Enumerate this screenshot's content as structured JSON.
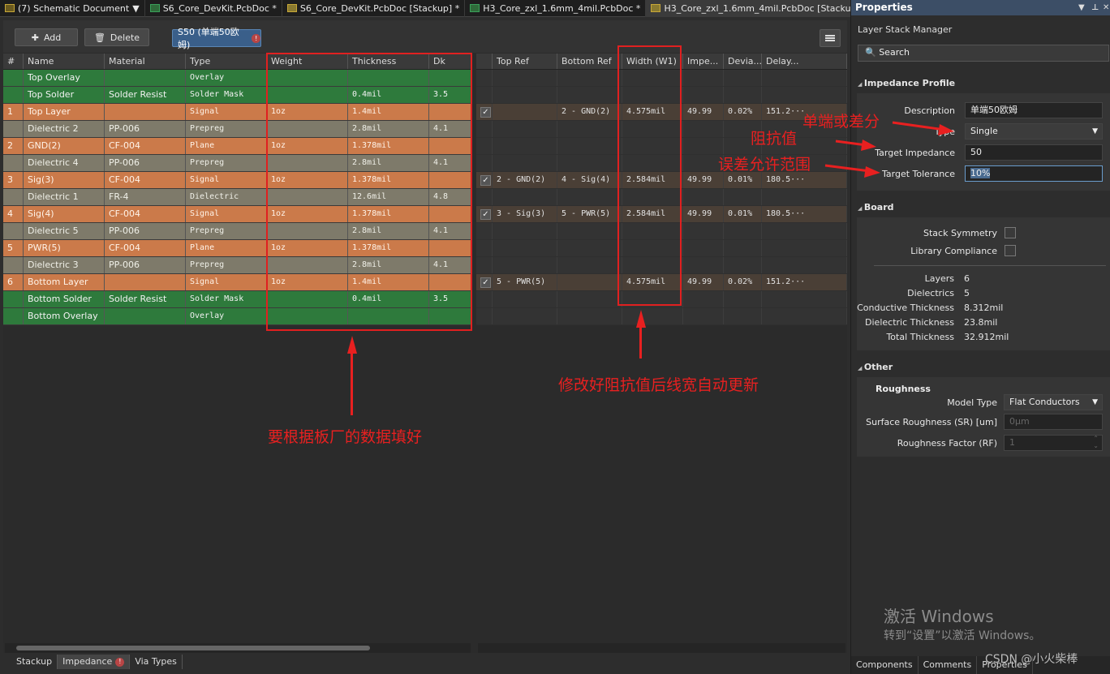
{
  "tabs": [
    "(7) Schematic Document",
    "S6_Core_DevKit.PcbDoc *",
    "S6_Core_DevKit.PcbDoc [Stackup] *",
    "H3_Core_zxl_1.6mm_4mil.PcbDoc *",
    "H3_Core_zxl_1.6mm_4mil.PcbDoc [Stackup] *"
  ],
  "toolbar": {
    "add": "Add",
    "delete": "Delete",
    "profile": "S50 (单端50欧姆)",
    "warn": "!"
  },
  "left_headers": [
    "#",
    "Name",
    "Material",
    "Type",
    "Weight",
    "Thickness",
    "Dk"
  ],
  "layers": [
    {
      "num": "",
      "name": "Top Overlay",
      "material": "",
      "type": "Overlay",
      "weight": "",
      "thickness": "",
      "dk": "",
      "cls": "Overlay",
      "ell": false
    },
    {
      "num": "",
      "name": "Top Solder",
      "material": "Solder Resist",
      "type": "Solder Mask",
      "weight": "",
      "thickness": "0.4mil",
      "dk": "3.5",
      "cls": "SolderMask",
      "ell": true
    },
    {
      "num": "1",
      "name": "Top Layer",
      "material": "",
      "type": "Signal",
      "weight": "1oz",
      "thickness": "1.4mil",
      "dk": "",
      "cls": "Signal",
      "ell": true
    },
    {
      "num": "",
      "name": "Dielectric 2",
      "material": "PP-006",
      "type": "Prepreg",
      "weight": "",
      "thickness": "2.8mil",
      "dk": "4.1",
      "cls": "Dielectric",
      "ell": true
    },
    {
      "num": "2",
      "name": "GND(2)",
      "material": "CF-004",
      "type": "Plane",
      "weight": "1oz",
      "thickness": "1.378mil",
      "dk": "",
      "cls": "Plane",
      "ell": true
    },
    {
      "num": "",
      "name": "Dielectric 4",
      "material": "PP-006",
      "type": "Prepreg",
      "weight": "",
      "thickness": "2.8mil",
      "dk": "4.1",
      "cls": "Dielectric",
      "ell": true
    },
    {
      "num": "3",
      "name": "Sig(3)",
      "material": "CF-004",
      "type": "Signal",
      "weight": "1oz",
      "thickness": "1.378mil",
      "dk": "",
      "cls": "Signal",
      "ell": true
    },
    {
      "num": "",
      "name": "Dielectric 1",
      "material": "FR-4",
      "type": "Dielectric",
      "weight": "",
      "thickness": "12.6mil",
      "dk": "4.8",
      "cls": "Dielectric",
      "ell": true
    },
    {
      "num": "4",
      "name": "Sig(4)",
      "material": "CF-004",
      "type": "Signal",
      "weight": "1oz",
      "thickness": "1.378mil",
      "dk": "",
      "cls": "Signal",
      "ell": true
    },
    {
      "num": "",
      "name": "Dielectric 5",
      "material": "PP-006",
      "type": "Prepreg",
      "weight": "",
      "thickness": "2.8mil",
      "dk": "4.1",
      "cls": "Dielectric",
      "ell": true
    },
    {
      "num": "5",
      "name": "PWR(5)",
      "material": "CF-004",
      "type": "Plane",
      "weight": "1oz",
      "thickness": "1.378mil",
      "dk": "",
      "cls": "Plane",
      "ell": true
    },
    {
      "num": "",
      "name": "Dielectric 3",
      "material": "PP-006",
      "type": "Prepreg",
      "weight": "",
      "thickness": "2.8mil",
      "dk": "4.1",
      "cls": "Dielectric",
      "ell": true
    },
    {
      "num": "6",
      "name": "Bottom Layer",
      "material": "",
      "type": "Signal",
      "weight": "1oz",
      "thickness": "1.4mil",
      "dk": "",
      "cls": "Signal",
      "ell": true
    },
    {
      "num": "",
      "name": "Bottom Solder",
      "material": "Solder Resist",
      "type": "Solder Mask",
      "weight": "",
      "thickness": "0.4mil",
      "dk": "3.5",
      "cls": "SolderMask",
      "ell": false
    },
    {
      "num": "",
      "name": "Bottom Overlay",
      "material": "",
      "type": "Overlay",
      "weight": "",
      "thickness": "",
      "dk": "",
      "cls": "Overlay",
      "ell": false
    }
  ],
  "right_headers": [
    "",
    "Top Ref",
    "Bottom Ref",
    "Width (W1)",
    "Impe...",
    "Devia...",
    "Delay..."
  ],
  "impedance_rows": [
    {
      "on": false
    },
    {
      "on": false
    },
    {
      "on": true,
      "top": "",
      "bottom": "2 - GND(2)",
      "width": "4.575mil",
      "imp": "49.99",
      "dev": "0.02%",
      "delay": "151.2···"
    },
    {
      "on": false
    },
    {
      "on": false
    },
    {
      "on": false
    },
    {
      "on": true,
      "top": "2 - GND(2)",
      "bottom": "4 - Sig(4)",
      "width": "2.584mil",
      "imp": "49.99",
      "dev": "0.01%",
      "delay": "180.5···"
    },
    {
      "on": false
    },
    {
      "on": true,
      "top": "3 - Sig(3)",
      "bottom": "5 - PWR(5)",
      "width": "2.584mil",
      "imp": "49.99",
      "dev": "0.01%",
      "delay": "180.5···"
    },
    {
      "on": false
    },
    {
      "on": false
    },
    {
      "on": false
    },
    {
      "on": true,
      "top": "5 - PWR(5)",
      "bottom": "",
      "width": "4.575mil",
      "imp": "49.99",
      "dev": "0.02%",
      "delay": "151.2···"
    },
    {
      "on": false
    },
    {
      "on": false
    }
  ],
  "bottom_tabs": [
    "Stackup",
    "Impedance",
    "Via Types"
  ],
  "annotations": {
    "fill": "要根据板厂的数据填好",
    "width": "修改好阻抗值后线宽自动更新",
    "type": "单端或差分",
    "imp": "阻抗值",
    "tol": "误差允许范围"
  },
  "props": {
    "title": "Properties",
    "subtitle": "Layer Stack Manager",
    "search": "Search",
    "impedance_profile": "Impedance Profile",
    "desc_label": "Description",
    "desc_value": "单端50欧姆",
    "type_label": "Type",
    "type_value": "Single",
    "ti_label": "Target Impedance",
    "ti_value": "50",
    "tt_label": "Target Tolerance",
    "tt_value": "10%",
    "board": "Board",
    "stack_sym": "Stack Symmetry",
    "lib_comp": "Library Compliance",
    "stats": [
      [
        "Layers",
        "6"
      ],
      [
        "Dielectrics",
        "5"
      ],
      [
        "Conductive Thickness",
        "8.312mil"
      ],
      [
        "Dielectric Thickness",
        "23.8mil"
      ],
      [
        "Total Thickness",
        "32.912mil"
      ]
    ],
    "other": "Other",
    "roughness": "Roughness",
    "model_label": "Model Type",
    "model_value": "Flat Conductors",
    "sr_label": "Surface Roughness (SR) [um]",
    "sr_value": "0μm",
    "rf_label": "Roughness Factor (RF)",
    "rf_value": "1"
  },
  "watermark": {
    "l1": "激活 Windows",
    "l2": "转到“设置”以激活 Windows。"
  },
  "panel_tabs": [
    "Components",
    "Comments",
    "Properties"
  ],
  "csdn": "CSDN @小火柴棒"
}
